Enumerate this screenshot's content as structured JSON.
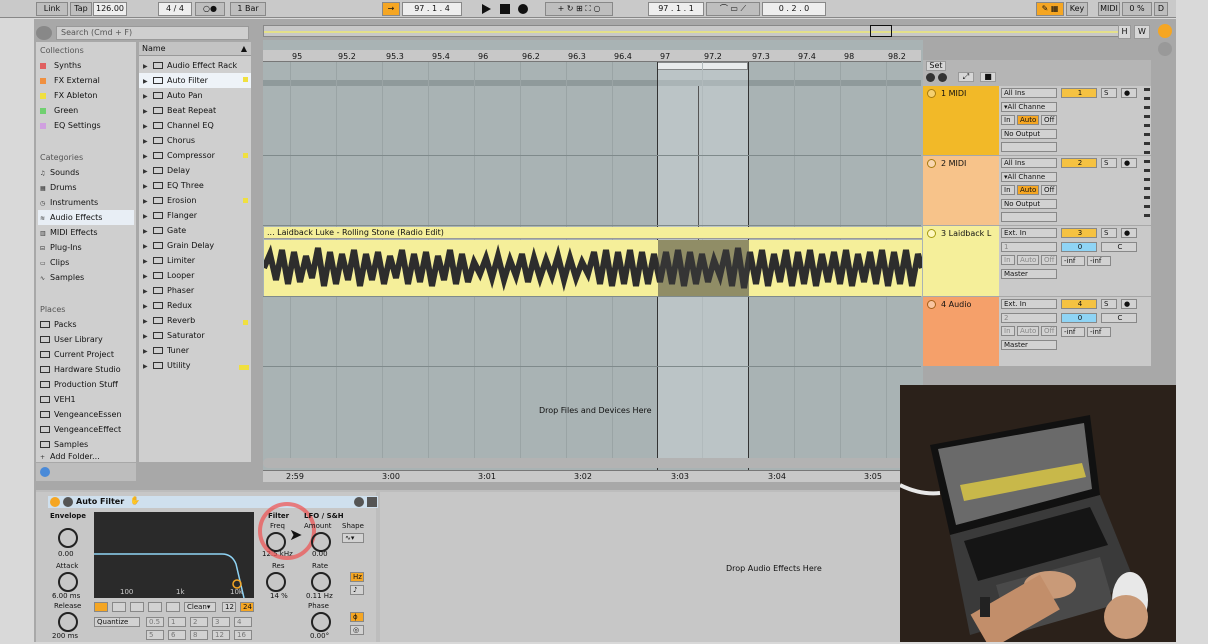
{
  "top": {
    "link": "Link",
    "tap": "Tap",
    "tempo": "126.00",
    "sig": "4 / 4",
    "quant": "1 Bar",
    "pos1": "97 .  1 .  4",
    "pos2": "97 .  1 .  1",
    "len": "0 .  2 .  0",
    "key": "Key",
    "midi": "MIDI",
    "cpu": "0 %",
    "d": "D"
  },
  "browser": {
    "search": "Search (Cmd + F)",
    "collections_h": "Collections",
    "collections": [
      {
        "label": "Synths",
        "color": "#e06060"
      },
      {
        "label": "FX External",
        "color": "#f09040"
      },
      {
        "label": "FX Ableton",
        "color": "#f0e040"
      },
      {
        "label": "Green",
        "color": "#70d070"
      },
      {
        "label": "EQ Settings",
        "color": "#d0a0e0"
      }
    ],
    "categories_h": "Categories",
    "categories": [
      "Sounds",
      "Drums",
      "Instruments",
      "Audio Effects",
      "MIDI Effects",
      "Plug-Ins",
      "Clips",
      "Samples"
    ],
    "places_h": "Places",
    "places": [
      "Packs",
      "User Library",
      "Current Project",
      "Hardware Studio",
      "Production Stuff",
      "VEH1",
      "VengeanceEssen",
      "VengeanceEffect",
      "Samples",
      "Add Folder..."
    ]
  },
  "plist": {
    "name_h": "Name",
    "items": [
      "Audio Effect Rack",
      "Auto Filter",
      "Auto Pan",
      "Beat Repeat",
      "Channel EQ",
      "Chorus",
      "Compressor",
      "Delay",
      "EQ Three",
      "Erosion",
      "Flanger",
      "Gate",
      "Grain Delay",
      "Limiter",
      "Looper",
      "Phaser",
      "Redux",
      "Reverb",
      "Saturator",
      "Tuner",
      "Utility"
    ]
  },
  "ruler": [
    "95",
    "95.2",
    "95.3",
    "95.4",
    "96",
    "96.2",
    "96.3",
    "96.4",
    "97",
    "97.2",
    "97.3",
    "97.4",
    "98",
    "98.2"
  ],
  "timeline": [
    "2:59",
    "3:00",
    "3:01",
    "3:02",
    "3:03",
    "3:04",
    "3:05"
  ],
  "clip": "... Laidback Luke - Rolling Stone (Radio Edit)",
  "drop_files": "Drop Files and Devices Here",
  "drop_fx": "Drop Audio Effects Here",
  "set": "Set",
  "tracks": [
    {
      "name": "1 MIDI",
      "color": "#f2b928",
      "in": "All Ins",
      "ch": "All Channe",
      "out": "No Output",
      "num": "1"
    },
    {
      "name": "2 MIDI",
      "color": "#f7c38a",
      "in": "All Ins",
      "ch": "All Channe",
      "out": "No Output",
      "num": "2"
    },
    {
      "name": "3 Laidback L",
      "color": "#f5ef9a",
      "in": "Ext. In",
      "ch": "1",
      "out": "Master",
      "num": "3",
      "vol": "0",
      "pan": "C",
      "inf1": "-inf",
      "inf2": "-inf"
    },
    {
      "name": "4 Audio",
      "color": "#f5a06a",
      "in": "Ext. In",
      "ch": "2",
      "out": "Master",
      "num": "4",
      "vol": "0",
      "pan": "C",
      "inf1": "-inf",
      "inf2": "-inf"
    }
  ],
  "monitor": {
    "in": "In",
    "auto": "Auto",
    "off": "Off",
    "s": "S"
  },
  "device": {
    "title": "Auto Filter",
    "envelope": "Envelope",
    "env_val": "0.00",
    "attack": "Attack",
    "attack_val": "6.00 ms",
    "release": "Release",
    "release_val": "200 ms",
    "filter": "Filter",
    "freq": "Freq",
    "freq_val": "12.5 kHz",
    "res": "Res",
    "res_val": "14 %",
    "lfo": "LFO / S&H",
    "amount": "Amount",
    "amount_val": "0.00",
    "shape": "Shape",
    "rate": "Rate",
    "rate_val": "0.11 Hz",
    "phase": "Phase",
    "phase_val": "0.00°",
    "hz": "Hz",
    "clean": "Clean",
    "n12": "12",
    "n24": "24",
    "quantize": "Quantize",
    "q": [
      "0.5",
      "1",
      "2",
      "3",
      "4",
      "5",
      "6",
      "8",
      "12",
      "16"
    ],
    "g100": "100",
    "g1k": "1k",
    "g10k": "10k"
  }
}
